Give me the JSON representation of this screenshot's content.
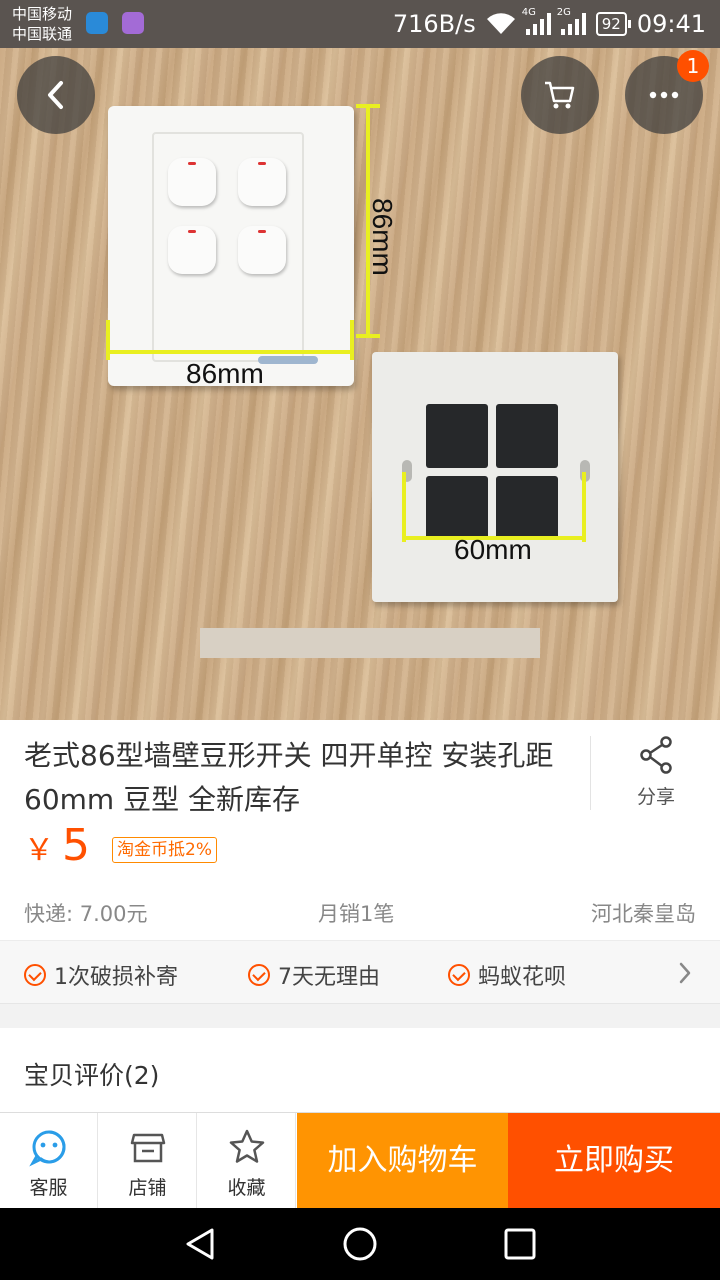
{
  "status_bar": {
    "carrier_1": "中国移动",
    "carrier_2": "中国联通",
    "net_speed": "716B/s",
    "net_4g": "4G",
    "net_2g": "2G",
    "battery": "92",
    "time": "09:41"
  },
  "overlay": {
    "back_icon": "chevron-left-icon",
    "cart_icon": "cart-icon",
    "more_icon": "more-dots-icon",
    "more_badge": "1"
  },
  "photo": {
    "label_front": "86mm",
    "label_height": "86mm",
    "label_hole": "60mm"
  },
  "product": {
    "title": "老式86型墙壁豆形开关 四开单控 安装孔距60mm 豆型 全新库存",
    "share_label": "分享",
    "currency": "￥",
    "price": "5",
    "coin_tag": "淘金币抵2%",
    "shipping": "快递: 7.00元",
    "monthly_sales": "月销1笔",
    "location": "河北秦皇岛"
  },
  "services": [
    {
      "label": "1次破损补寄"
    },
    {
      "label": "7天无理由"
    },
    {
      "label": "蚂蚁花呗"
    }
  ],
  "reviews": {
    "heading": "宝贝评价(2)"
  },
  "actions": {
    "service": "客服",
    "shop": "店铺",
    "favorite": "收藏",
    "add_to_cart": "加入购物车",
    "buy_now": "立即购买"
  },
  "colors": {
    "accent": "#ff5000",
    "cart_button": "#ff9402"
  }
}
